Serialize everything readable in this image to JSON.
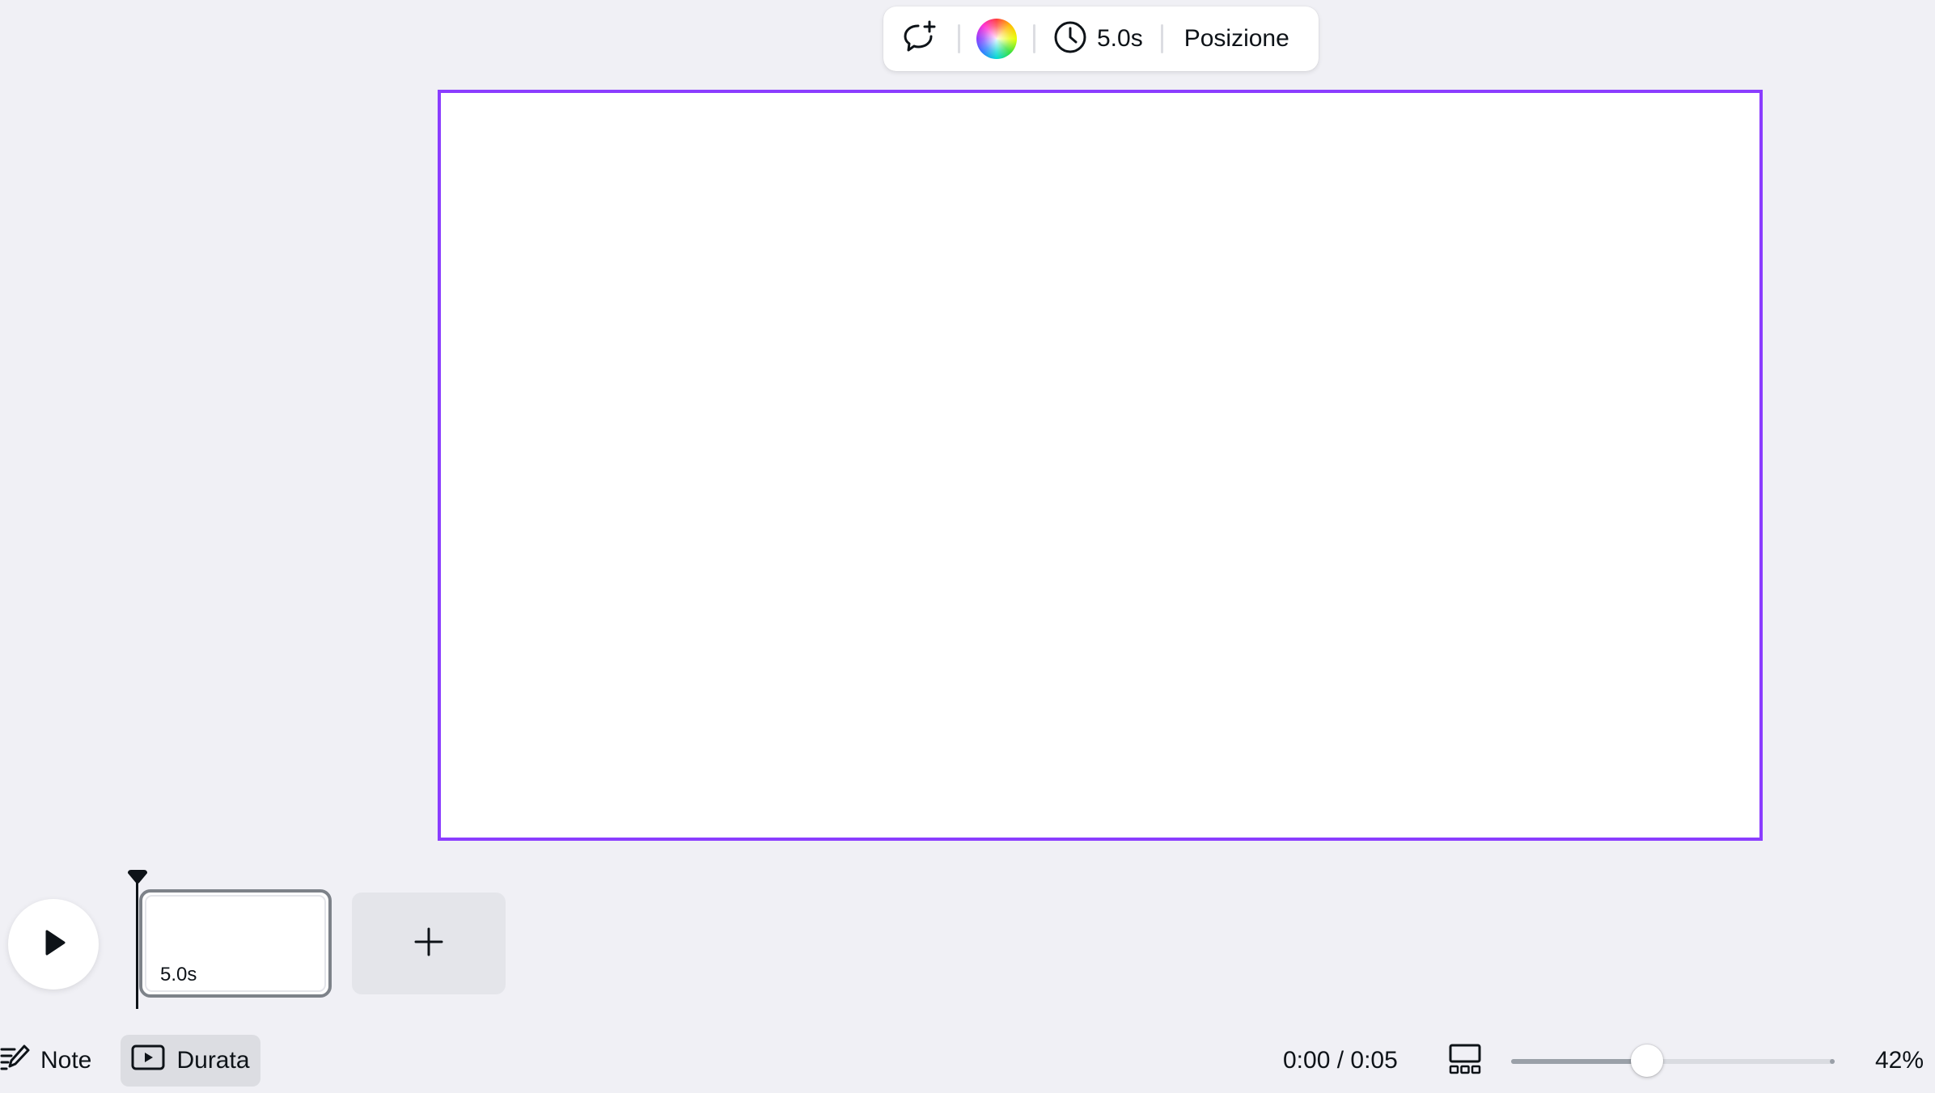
{
  "toolbar": {
    "comment_icon": "comment-add-icon",
    "color_icon": "color-wheel-icon",
    "timer_icon": "clock-icon",
    "duration_label": "5.0s",
    "position_label": "Posizione"
  },
  "canvas": {
    "selection_color": "#8b3dff"
  },
  "timeline": {
    "play_icon": "play-icon",
    "scenes": [
      {
        "duration_label": "5.0s"
      }
    ],
    "add_scene_icon": "plus-icon"
  },
  "bottom_bar": {
    "notes_label": "Note",
    "duration_label": "Durata",
    "time_display": "0:00 / 0:05",
    "zoom_level": 0.42,
    "zoom_label": "42%"
  }
}
